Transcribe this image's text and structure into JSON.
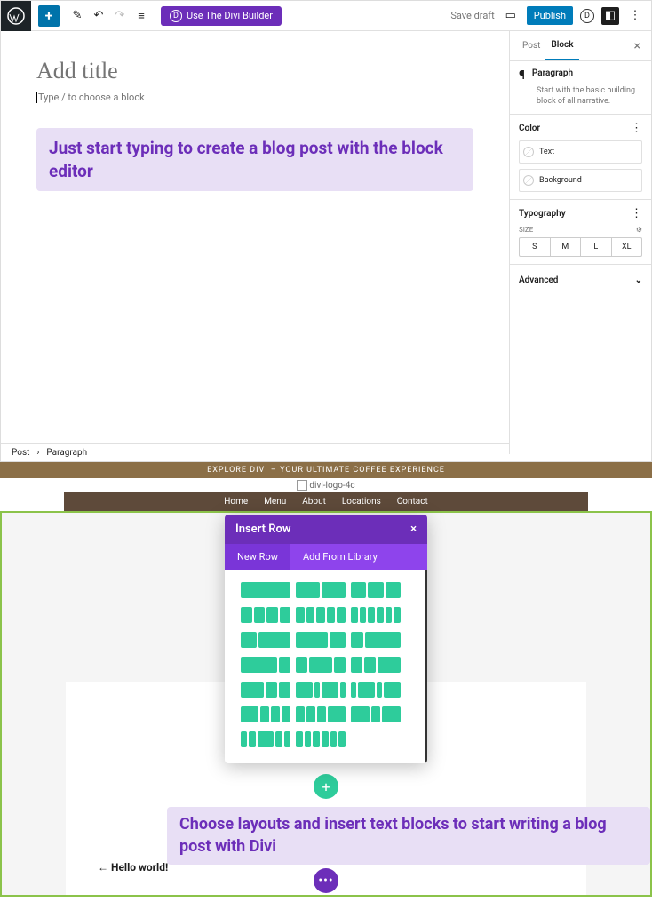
{
  "wp": {
    "toolbar": {
      "divi_button": "Use The Divi Builder",
      "save_draft": "Save draft",
      "publish": "Publish"
    },
    "canvas": {
      "title_placeholder": "Add title",
      "block_hint": "Type / to choose a block"
    },
    "annotation": "Just start typing to create a blog post with the block editor",
    "sidebar": {
      "tabs": {
        "post": "Post",
        "block": "Block"
      },
      "paragraph": {
        "title": "Paragraph",
        "desc": "Start with the basic building block of all narrative."
      },
      "color": {
        "title": "Color",
        "text": "Text",
        "background": "Background"
      },
      "typography": {
        "title": "Typography",
        "size_label": "SIZE",
        "sizes": [
          "S",
          "M",
          "L",
          "XL"
        ]
      },
      "advanced": "Advanced"
    },
    "breadcrumb": {
      "post": "Post",
      "paragraph": "Paragraph"
    }
  },
  "divi": {
    "banner": "EXPLORE DIVI – YOUR ULTIMATE COFFEE EXPERIENCE",
    "logo_alt": "divi-logo-4c",
    "nav": [
      "Home",
      "Menu",
      "About",
      "Locations",
      "Contact"
    ],
    "modal": {
      "title": "Insert Row",
      "tab_new": "New Row",
      "tab_library": "Add From Library"
    },
    "hello": "← Hello world!",
    "annotation": "Choose layouts and insert text blocks to start writing a blog post with Divi"
  }
}
